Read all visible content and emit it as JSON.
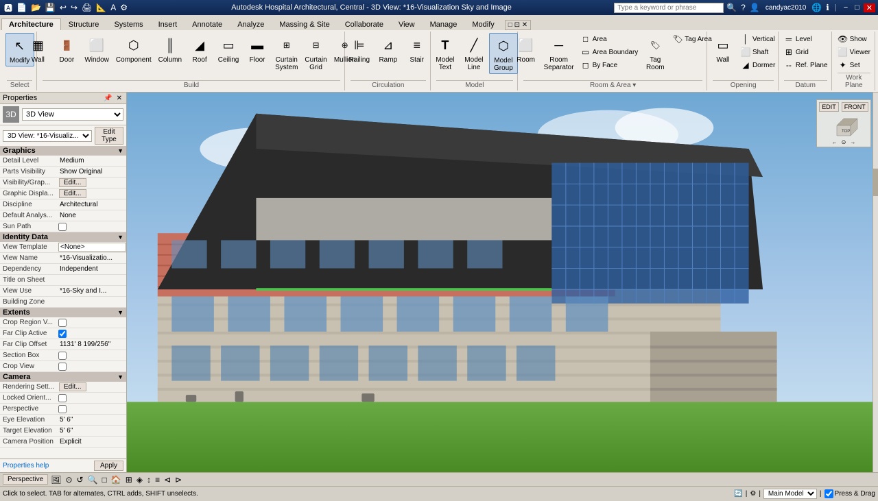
{
  "titlebar": {
    "app_name": "Autodesk",
    "title": "Autodesk Hospital Architectural, Central - 3D View: *16-Visualization Sky and Image",
    "search_placeholder": "Type a keyword or phrase",
    "user": "candyac2010",
    "min_label": "−",
    "max_label": "□",
    "close_label": "✕"
  },
  "ribbon": {
    "tabs": [
      "Architecture",
      "Structure",
      "Systems",
      "Insert",
      "Annotate",
      "Analyze",
      "Massing & Site",
      "Collaborate",
      "View",
      "Manage",
      "Modify"
    ],
    "active_tab": "Architecture",
    "groups": [
      {
        "name": "Select",
        "items": [
          {
            "label": "Modify",
            "icon": "↖",
            "type": "large"
          }
        ]
      },
      {
        "name": "Build",
        "items": [
          {
            "label": "Wall",
            "icon": "▦",
            "type": "large"
          },
          {
            "label": "Door",
            "icon": "🚪",
            "type": "large"
          },
          {
            "label": "Window",
            "icon": "⬜",
            "type": "large"
          },
          {
            "label": "Component",
            "icon": "⬡",
            "type": "large"
          },
          {
            "label": "Column",
            "icon": "║",
            "type": "large"
          },
          {
            "label": "Roof",
            "icon": "◢",
            "type": "large"
          },
          {
            "label": "Ceiling",
            "icon": "▭",
            "type": "large"
          },
          {
            "label": "Floor",
            "icon": "▬",
            "type": "large"
          },
          {
            "label": "Curtain System",
            "icon": "⊞",
            "type": "large"
          },
          {
            "label": "Curtain Grid",
            "icon": "⊟",
            "type": "large"
          },
          {
            "label": "Mullion",
            "icon": "⊕",
            "type": "large"
          }
        ]
      },
      {
        "name": "Circulation",
        "items": [
          {
            "label": "Railing",
            "icon": "⊫",
            "type": "large"
          },
          {
            "label": "Ramp",
            "icon": "⊿",
            "type": "large"
          },
          {
            "label": "Stair",
            "icon": "≡",
            "type": "large"
          }
        ]
      },
      {
        "name": "Model",
        "items": [
          {
            "label": "Model Text",
            "icon": "T",
            "type": "large"
          },
          {
            "label": "Model Line",
            "icon": "╱",
            "type": "large"
          },
          {
            "label": "Model Group",
            "icon": "⬡",
            "type": "large",
            "active": true
          }
        ]
      },
      {
        "name": "Room & Area",
        "items": [
          {
            "label": "Room",
            "icon": "⬜",
            "type": "large"
          },
          {
            "label": "Room Separator",
            "icon": "─",
            "type": "large"
          },
          {
            "label": "Tag Room",
            "icon": "🏷",
            "type": "large"
          },
          {
            "label": "Area",
            "icon": "□",
            "type": "small"
          },
          {
            "label": "Area Boundary",
            "icon": "▭",
            "type": "small"
          },
          {
            "label": "By Face",
            "icon": "◻",
            "type": "small"
          },
          {
            "label": "Tag Area",
            "icon": "🏷",
            "type": "small"
          }
        ]
      },
      {
        "name": "Opening",
        "items": [
          {
            "label": "Wall",
            "icon": "▭",
            "type": "large"
          },
          {
            "label": "Vertical",
            "icon": "│",
            "type": "small"
          },
          {
            "label": "Shaft",
            "icon": "⬜",
            "type": "small"
          },
          {
            "label": "Dormer",
            "icon": "◢",
            "type": "small"
          }
        ]
      },
      {
        "name": "Datum",
        "items": [
          {
            "label": "Level",
            "icon": "═",
            "type": "small"
          },
          {
            "label": "Grid",
            "icon": "⊞",
            "type": "small"
          },
          {
            "label": "Ref. Plane",
            "icon": "- -",
            "type": "small"
          }
        ]
      },
      {
        "name": "Work Plane",
        "items": [
          {
            "label": "Show",
            "icon": "👁",
            "type": "small"
          },
          {
            "label": "Viewer",
            "icon": "⬜",
            "type": "small"
          },
          {
            "label": "Set",
            "icon": "✦",
            "type": "small"
          }
        ]
      }
    ]
  },
  "properties_panel": {
    "title": "Properties",
    "type_label": "3D View",
    "view_dropdown": "3D View: *16-Visualiz...",
    "edit_type_label": "Edit Type",
    "sections": {
      "graphics": {
        "label": "Graphics",
        "rows": [
          {
            "label": "Detail Level",
            "value": "Medium"
          },
          {
            "label": "Parts Visibility",
            "value": "Show Original"
          },
          {
            "label": "Visibility/Grap...",
            "value": "",
            "has_edit": true
          },
          {
            "label": "Graphic Displa...",
            "value": "",
            "has_edit": true
          },
          {
            "label": "Discipline",
            "value": "Architectural"
          },
          {
            "label": "Default Analys...",
            "value": "None"
          },
          {
            "label": "Sun Path",
            "value": "",
            "has_check": true,
            "checked": false
          }
        ]
      },
      "identity_data": {
        "label": "Identity Data",
        "rows": [
          {
            "label": "View Template",
            "value": "<None>"
          },
          {
            "label": "View Name",
            "value": "*16-Visualizatio..."
          },
          {
            "label": "Dependency",
            "value": "Independent"
          },
          {
            "label": "Title on Sheet",
            "value": ""
          },
          {
            "label": "View Use",
            "value": "*16-Sky and I..."
          },
          {
            "label": "Building Zone",
            "value": ""
          }
        ]
      },
      "extents": {
        "label": "Extents",
        "rows": [
          {
            "label": "Crop Region V...",
            "value": "",
            "has_check": true,
            "checked": false
          },
          {
            "label": "Far Clip Active",
            "value": "",
            "has_check": true,
            "checked": true
          },
          {
            "label": "Far Clip Offset",
            "value": "1131' 8 199/256\""
          },
          {
            "label": "Section Box",
            "value": "",
            "has_check": true,
            "checked": false
          },
          {
            "label": "Crop View",
            "value": "",
            "has_check": true,
            "checked": false
          }
        ]
      },
      "camera": {
        "label": "Camera",
        "rows": [
          {
            "label": "Rendering Sett...",
            "value": "",
            "has_edit": true
          },
          {
            "label": "Locked Orient...",
            "value": "",
            "has_check": true,
            "checked": false
          },
          {
            "label": "Perspective",
            "value": "",
            "has_check": true,
            "checked": false
          },
          {
            "label": "Eye Elevation",
            "value": "5' 6\""
          },
          {
            "label": "Target Elevation",
            "value": "5' 6\""
          },
          {
            "label": "Camera Position",
            "value": "Explicit"
          }
        ]
      }
    },
    "properties_help_label": "Properties help",
    "apply_label": "Apply"
  },
  "statusbar": {
    "perspective_label": "Perspective",
    "bottom_text": "Click to select. TAB for alternates, CTRL adds, SHIFT unselects.",
    "model_label": "Main Model",
    "press_drag_label": "Press & Drag"
  },
  "view_cube": {
    "edit_label": "EDIT",
    "front_label": "FRONT"
  }
}
